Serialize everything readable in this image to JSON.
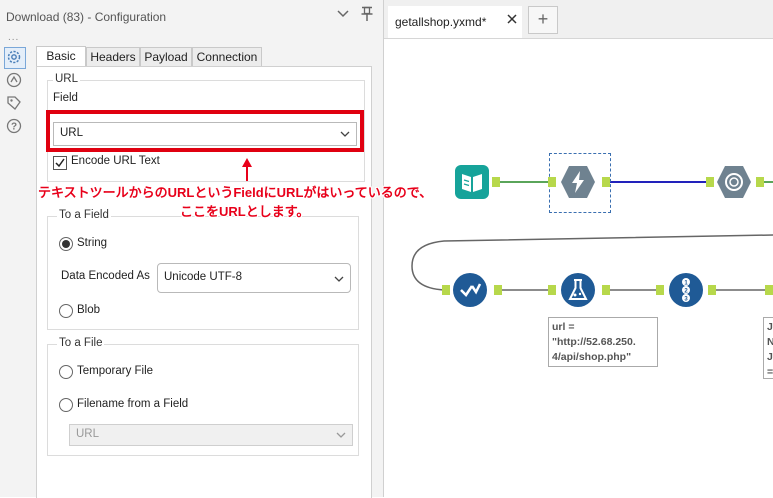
{
  "panel": {
    "title": "Download (83) - Configuration",
    "dots": "...",
    "tabs": [
      "Basic",
      "Headers",
      "Payload",
      "Connection"
    ],
    "url_group": {
      "legend": "URL",
      "field_label": "Field",
      "field_value": "URL",
      "encode_label": "Encode URL Text",
      "encode_checked": true
    },
    "to_field": {
      "legend": "To a Field",
      "string_label": "String",
      "string_selected": true,
      "encoded_as_label": "Data Encoded As",
      "encoded_as_value": "Unicode UTF-8",
      "blob_label": "Blob"
    },
    "to_file": {
      "legend": "To a File",
      "temp_label": "Temporary File",
      "filename_label": "Filename from a Field",
      "filename_value": "URL"
    }
  },
  "annotation": {
    "line1": "テキストツールからのURLというFieldにURLがはいっているので、",
    "line2": "ここをURLとします。",
    "color": "#e8001a"
  },
  "canvas": {
    "doc_tab": "getallshop.yxmd*",
    "add_tab": "+",
    "annotation_box": "url =\n\"http://52.68.250.\n4/api/shop.php\"",
    "partial_box": "J\nN\nJ\n="
  }
}
